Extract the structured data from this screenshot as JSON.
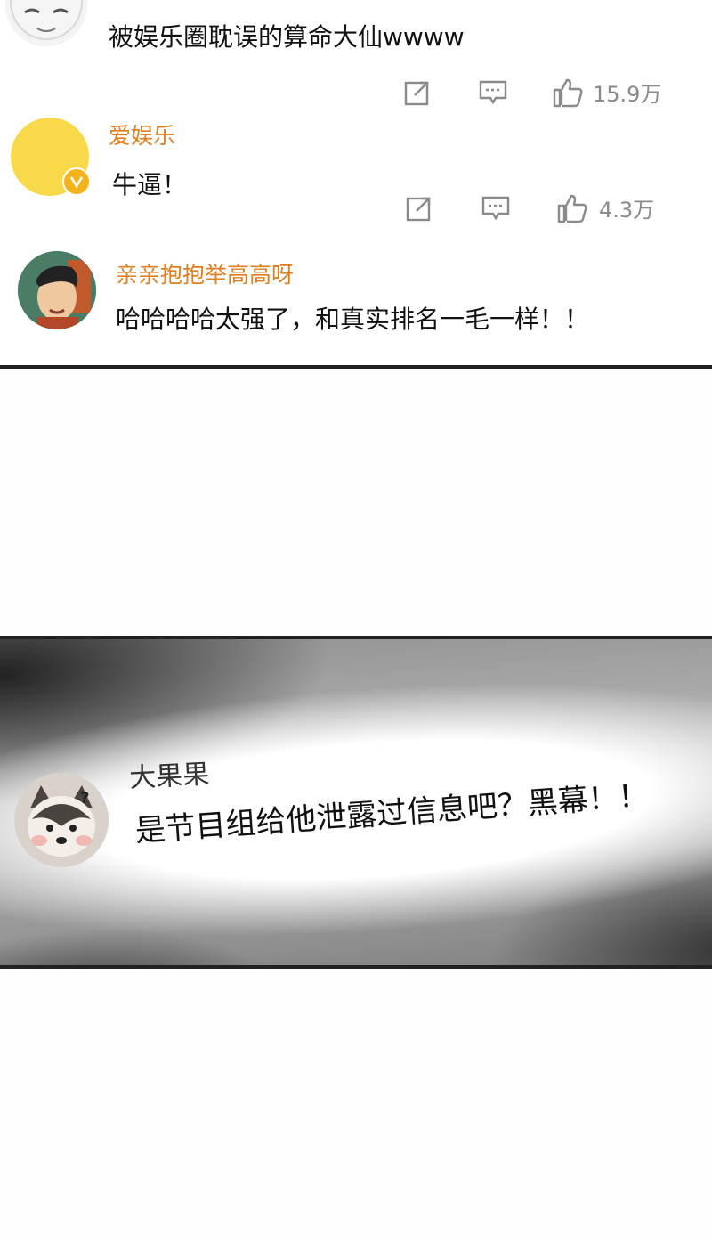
{
  "comments": [
    {
      "text": "被娱乐圈耽误的算命大仙wwww",
      "actions": {
        "share_icon": "share-icon",
        "comment_icon": "comment-icon",
        "like_icon": "thumbs-up-icon",
        "likes": "15.9万"
      }
    },
    {
      "name": "爱娱乐",
      "verified": true,
      "text": "牛逼！",
      "actions": {
        "share_icon": "share-icon",
        "comment_icon": "comment-icon",
        "like_icon": "thumbs-up-icon",
        "likes": "4.3万"
      }
    },
    {
      "name": "亲亲抱抱举高高呀",
      "text": "哈哈哈哈太强了，和真实排名一毛一样！！"
    }
  ],
  "featured_comment": {
    "name": "大果果",
    "text": "是节目组给他泄露过信息吧？黑幕！！"
  },
  "colors": {
    "name_orange": "#e07f1f",
    "verified_badge": "#f2b31b",
    "avatar_yellow": "#f7d94a"
  }
}
